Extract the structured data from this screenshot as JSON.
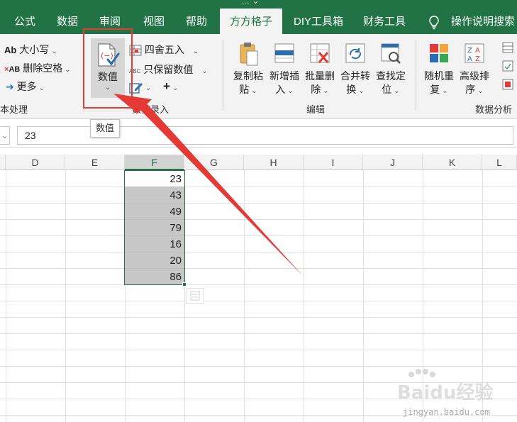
{
  "window": {
    "title_fragment": "… ⌄"
  },
  "tabs": [
    {
      "label": "公式",
      "active": false
    },
    {
      "label": "数据",
      "active": false
    },
    {
      "label": "审阅",
      "active": false
    },
    {
      "label": "视图",
      "active": false
    },
    {
      "label": "帮助",
      "active": false
    },
    {
      "label": "方方格子",
      "active": true
    },
    {
      "label": "DIY工具箱",
      "active": false
    },
    {
      "label": "财务工具",
      "active": false
    }
  ],
  "search": {
    "label": "操作说明搜索",
    "icon": "lightbulb-icon"
  },
  "ribbon": {
    "text_group": {
      "case_label": "大小写",
      "case_icon_text": "Ab",
      "remove_space_label": "删除空格",
      "remove_space_icon_text": "AB",
      "more_label": "更多",
      "group_label": "本处理"
    },
    "number_group": {
      "number_label": "数值",
      "round_label": "四舍五入",
      "keep_value_label": "只保留数值",
      "keep_value_icon_text": "ABC",
      "plus_label": "+",
      "group_label": "数值录入"
    },
    "edit_group": {
      "copy_paste": [
        "复制粘",
        "贴"
      ],
      "insert": [
        "新增插",
        "入"
      ],
      "batch_delete": [
        "批量删",
        "除"
      ],
      "merge_convert": [
        "合并转",
        "换"
      ],
      "find_locate": [
        "查找定",
        "位"
      ],
      "group_label": "编辑"
    },
    "analysis_group": {
      "random_repeat": [
        "随机重",
        "复"
      ],
      "advanced_sort": [
        "高级排",
        "序"
      ],
      "group_label": "数据分析"
    }
  },
  "tooltip": {
    "text": "数值"
  },
  "formula_bar": {
    "value": "23"
  },
  "grid": {
    "columns": [
      "D",
      "E",
      "F",
      "G",
      "H",
      "I",
      "J",
      "K",
      "L"
    ],
    "selected_column": "F",
    "f_values": [
      "23",
      "43",
      "49",
      "79",
      "16",
      "20",
      "86"
    ]
  },
  "watermark": {
    "logo_text": "Baidu经验",
    "url_text": "jingyan.baidu.com"
  },
  "colors": {
    "accent": "#217346",
    "highlight": "#e53935",
    "selection_fill": "#c7c7c7"
  }
}
